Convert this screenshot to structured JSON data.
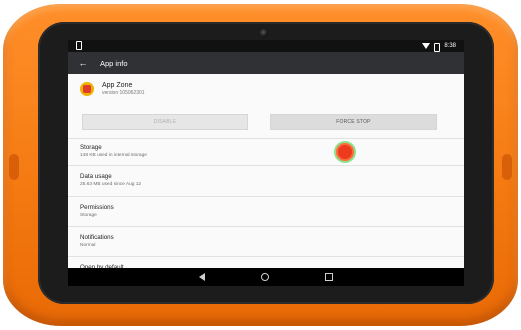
{
  "status_bar": {
    "time": "8:38"
  },
  "app_bar": {
    "title": "App info"
  },
  "app": {
    "name": "App Zone",
    "version": "version 105062301"
  },
  "buttons": {
    "disable": "DISABLE",
    "force_stop": "FORCE STOP"
  },
  "sections": [
    {
      "title": "Storage",
      "subtitle": "148 KB used in internal storage"
    },
    {
      "title": "Data usage",
      "subtitle": "25.63 MB used since Aug 12"
    },
    {
      "title": "Permissions",
      "subtitle": "Storage"
    },
    {
      "title": "Notifications",
      "subtitle": "Normal"
    },
    {
      "title": "Open by default",
      "subtitle": ""
    }
  ],
  "colors": {
    "bumper": "#f57a12",
    "touch_marker": "#ee3a1c",
    "appbar": "#2f3134"
  }
}
